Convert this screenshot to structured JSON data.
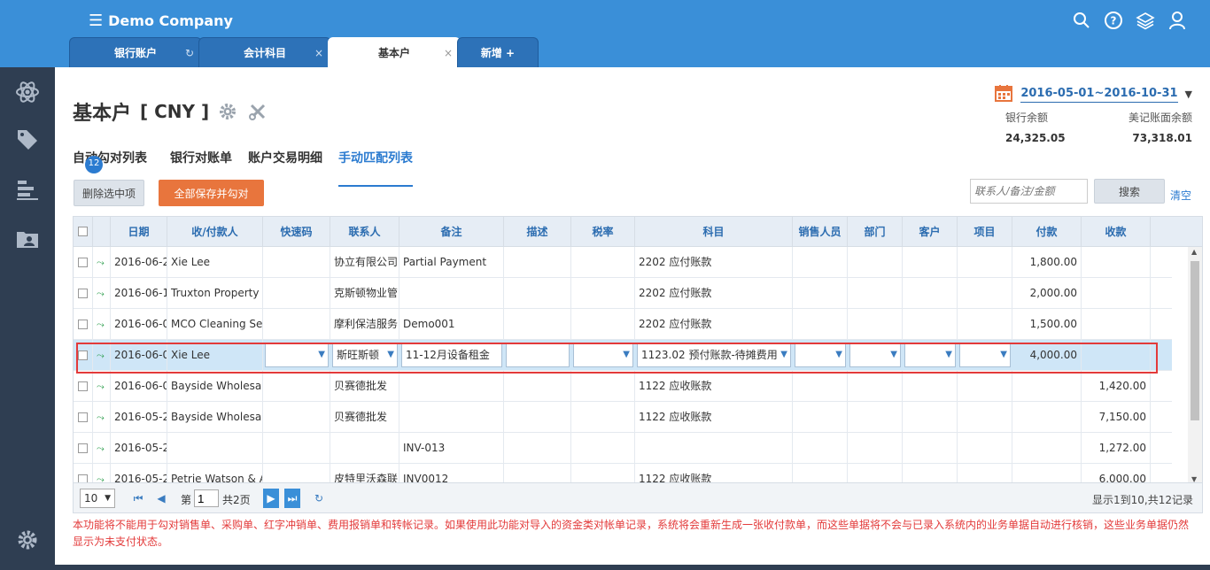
{
  "app": {
    "title": "Demo Company"
  },
  "tabs": [
    {
      "label": "银行账户",
      "icon": "refresh-icon"
    },
    {
      "label": "会计科目",
      "close": "×"
    },
    {
      "label": "基本户",
      "close": "×"
    },
    {
      "label": "新增 +"
    }
  ],
  "page": {
    "title": "基本户",
    "currency": "[ CNY ]",
    "date_range": "2016-05-01~2016-10-31",
    "bank_balance_label": "银行余额",
    "bank_balance": "24,325.05",
    "book_balance_label": "美记账面余额",
    "book_balance": "73,318.01"
  },
  "subtabs": [
    {
      "label": "自动勾对列表",
      "badge": "12"
    },
    {
      "label": "银行对账单"
    },
    {
      "label": "账户交易明细"
    },
    {
      "label": "手动匹配列表"
    }
  ],
  "toolbar": {
    "delete_label": "删除选中项",
    "save_label": "全部保存并勾对",
    "search_placeholder": "联系人/备注/金额",
    "search_label": "搜索",
    "clear_label": "清空"
  },
  "table": {
    "headers": [
      "日期",
      "收/付款人",
      "快速码",
      "联系人",
      "备注",
      "描述",
      "税率",
      "科目",
      "销售人员",
      "部门",
      "客户",
      "项目",
      "付款",
      "收款"
    ],
    "rows": [
      {
        "date": "2016-06-2",
        "payee": "Xie Lee",
        "contact": "协立有限公司",
        "memo": "Partial Payment",
        "account": "2202 应付账款",
        "pay": "1,800.00",
        "recv": ""
      },
      {
        "date": "2016-06-1",
        "payee": "Truxton Property",
        "contact": "克斯顿物业管",
        "memo": "",
        "account": "2202 应付账款",
        "pay": "2,000.00",
        "recv": ""
      },
      {
        "date": "2016-06-0",
        "payee": "MCO Cleaning Se",
        "contact": "摩利保洁服务",
        "memo": "Demo001",
        "account": "2202 应付账款",
        "pay": "1,500.00",
        "recv": ""
      },
      {
        "date": "2016-06-0",
        "payee": "Xie Lee",
        "contact": "斯旺斯顿",
        "memo": "11-12月设备租金",
        "account": "1123.02 预付账款-待摊费用",
        "pay": "4,000.00",
        "recv": "",
        "editing": true
      },
      {
        "date": "2016-06-0",
        "payee": "Bayside Wholesale",
        "contact": "贝赛德批发",
        "memo": "",
        "account": "1122 应收账款",
        "pay": "",
        "recv": "1,420.00"
      },
      {
        "date": "2016-05-2",
        "payee": "Bayside Wholesale",
        "contact": "贝赛德批发",
        "memo": "",
        "account": "1122 应收账款",
        "pay": "",
        "recv": "7,150.00"
      },
      {
        "date": "2016-05-2",
        "payee": "",
        "contact": "",
        "memo": "INV-013",
        "account": "",
        "pay": "",
        "recv": "1,272.00"
      },
      {
        "date": "2016-05-2",
        "payee": "Petrie Watson & A",
        "contact": "皮特里沃森联",
        "memo": "INV0012",
        "account": "1122 应收账款",
        "pay": "",
        "recv": "6,000.00"
      }
    ]
  },
  "pager": {
    "page_size": "10",
    "page_prefix": "第",
    "page_value": "1",
    "total_pages": "共2页",
    "info": "显示1到10,共12记录"
  },
  "notice": "本功能将不能用于勾对销售单、采购单、红字冲销单、费用报销单和转帐记录。如果使用此功能对导入的资金类对帐单记录，系统将会重新生成一张收付款单，而这些单据将不会与已录入系统内的业务单据自动进行核销，这些业务单据仍然显示为未支付状态。",
  "colors": {
    "brand": "#3a8fd8",
    "sidebar": "#2f3e52",
    "accent": "#e8753d",
    "highlight": "#e33a3a"
  }
}
